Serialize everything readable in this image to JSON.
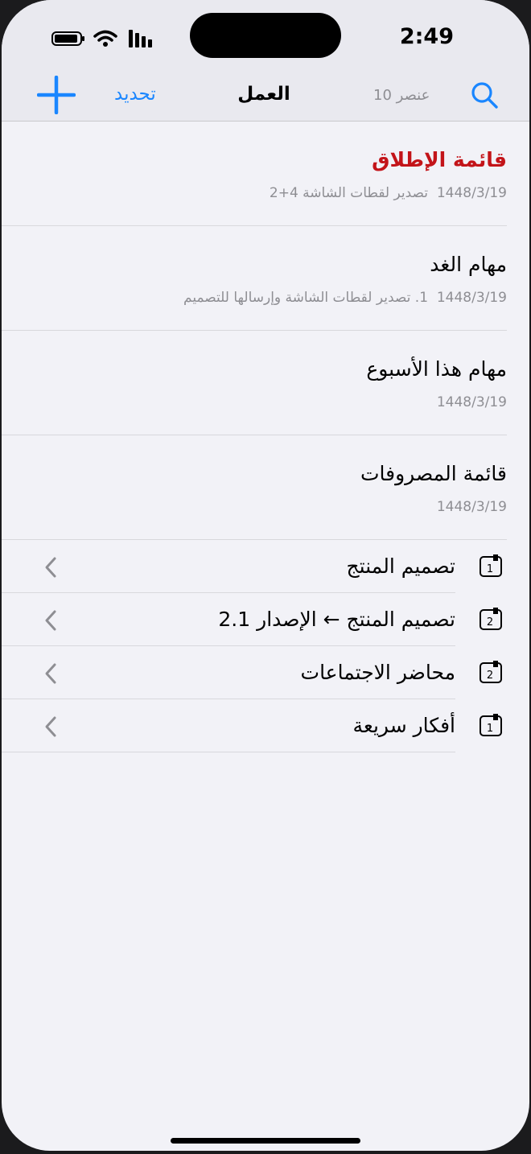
{
  "status": {
    "time": "2:49"
  },
  "nav": {
    "add_icon": "plus-icon",
    "refresh_label": "تحديد",
    "title": "العمل",
    "count": "10 عنصر",
    "search_icon": "search-icon"
  },
  "notes": [
    {
      "title": "قائمة الإطلاق",
      "date": "1448/3/19",
      "preview": "تصدير لقطات الشاشة 4+2",
      "title_color": "#c31419"
    },
    {
      "title": "مهام الغد",
      "date": "1448/3/19",
      "preview": "1. تصدير لقطات الشاشة وإرسالها للتصميم",
      "title_color": "#000000"
    },
    {
      "title": "مهام هذا الأسبوع",
      "date": "1448/3/19",
      "preview": "",
      "title_color": "#000000"
    },
    {
      "title": "قائمة المصروفات",
      "date": "1448/3/19",
      "preview": "",
      "title_color": "#000000"
    }
  ],
  "folders": [
    {
      "name": "تصميم المنتج",
      "count": "1"
    },
    {
      "name": "تصميم المنتج ← الإصدار 2.1",
      "count": "2"
    },
    {
      "name": "محاضر الاجتماعات",
      "count": "2"
    },
    {
      "name": "أفكار سريعة",
      "count": "1"
    }
  ],
  "colors": {
    "accent": "#1a86ff",
    "background": "#f2f2f7",
    "muted": "#8e8e93"
  }
}
